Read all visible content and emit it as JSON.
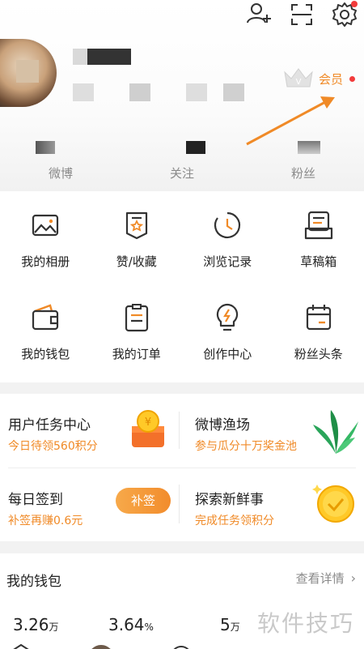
{
  "profile": {
    "vip_label": "会员"
  },
  "stats": [
    {
      "label": "微博"
    },
    {
      "label": "关注"
    },
    {
      "label": "粉丝"
    }
  ],
  "menu": [
    {
      "label": "我的相册",
      "icon": "photo-album-icon"
    },
    {
      "label": "赞/收藏",
      "icon": "favorite-icon"
    },
    {
      "label": "浏览记录",
      "icon": "history-clock-icon"
    },
    {
      "label": "草稿箱",
      "icon": "drafts-icon"
    },
    {
      "label": "我的钱包",
      "icon": "wallet-icon"
    },
    {
      "label": "我的订单",
      "icon": "order-icon"
    },
    {
      "label": "创作中心",
      "icon": "creator-bulb-icon"
    },
    {
      "label": "粉丝头条",
      "icon": "fans-headline-icon"
    }
  ],
  "tasks": {
    "user_task_center": {
      "title": "用户任务中心",
      "subtitle": "今日待领560积分"
    },
    "weibo_fishery": {
      "title": "微博渔场",
      "subtitle": "参与瓜分十万奖金池"
    },
    "daily_checkin": {
      "title": "每日签到",
      "subtitle": "补签再赚0.6元",
      "button": "补签"
    },
    "explore": {
      "title": "探索新鲜事",
      "subtitle": "完成任务领积分"
    }
  },
  "wallet": {
    "title": "我的钱包",
    "more_label": "查看详情",
    "values": [
      {
        "value": "3.26",
        "unit": "万"
      },
      {
        "value": "3.64",
        "unit": "%"
      },
      {
        "value": "5",
        "unit": "万"
      }
    ]
  },
  "watermark": "软件技巧",
  "colors": {
    "accent": "#f08a27",
    "badge_red": "#f23b3b"
  }
}
